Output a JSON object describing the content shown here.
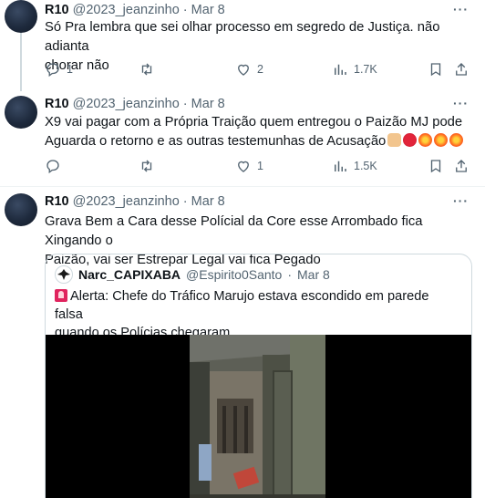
{
  "tweets": [
    {
      "name": "R10",
      "handle": "@2023_jeanzinho",
      "sep": "·",
      "date": "Mar 8",
      "lines": [
        "Só Pra lembra que sei olhar processo em segredo de Justiça.  não adianta",
        "chorar não"
      ],
      "replies": "1",
      "retweets": "",
      "likes": "2",
      "views": "1.7K"
    },
    {
      "name": "R10",
      "handle": "@2023_jeanzinho",
      "sep": "·",
      "date": "Mar 8",
      "lines": [
        "X9 vai pagar com a Própria Traição quem entregou o Paizão MJ pode",
        "Aguarda o retorno e as outras testemunhas de Acusação"
      ],
      "replies": "",
      "retweets": "",
      "likes": "1",
      "views": "1.5K"
    },
    {
      "name": "R10",
      "handle": "@2023_jeanzinho",
      "sep": "·",
      "date": "Mar 8",
      "lines": [
        "Grava Bem a Cara desse Polícial da Core esse Arrombado fica Xingando o",
        "Paizão, vai ser Estrepar Legal vai fica Pegado"
      ]
    }
  ],
  "quote": {
    "name": "Narc_CAPIXABA",
    "handle": "@Espirito0Santo",
    "sep": "·",
    "date": "Mar 8",
    "lines": [
      "Alerta: Chefe do Tráfico Marujo estava escondido em parede falsa",
      "quando os Polícias chegaram"
    ]
  },
  "more_label": "···",
  "icons": [
    "reply-icon",
    "retweet-icon",
    "like-icon",
    "views-icon",
    "bookmark-icon",
    "share-icon",
    "siren-emoji",
    "hand-emoji",
    "angry-emoji",
    "explosion-emoji"
  ],
  "colors": {
    "muted": "#536471",
    "border": "#cfd9de",
    "divider": "#eff3f4"
  }
}
